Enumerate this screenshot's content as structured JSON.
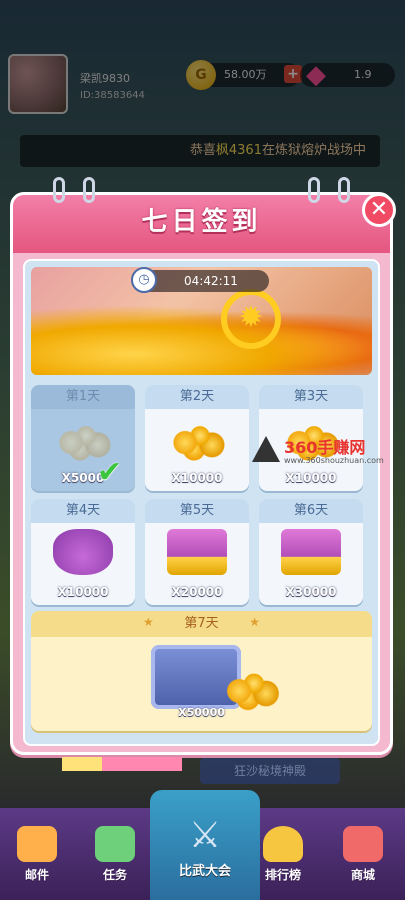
{
  "profile": {
    "name": "梁凯9830",
    "id": "ID:38583644"
  },
  "resources": {
    "coins": "58.00万",
    "coin_symbol": "G",
    "gems": "1.9"
  },
  "ticker": {
    "prefix": "恭喜",
    "name": "枫4361",
    "suffix": "在炼狱熔炉战场中"
  },
  "dialog": {
    "title": "七日签到",
    "timer": "04:42:11",
    "days": [
      {
        "label": "第1天",
        "amount": "X5000",
        "reward": "coins",
        "claimed": true
      },
      {
        "label": "第2天",
        "amount": "X10000",
        "reward": "coins",
        "claimed": false
      },
      {
        "label": "第3天",
        "amount": "X10000",
        "reward": "coins",
        "claimed": false
      },
      {
        "label": "第4天",
        "amount": "X10000",
        "reward": "purse",
        "claimed": false
      },
      {
        "label": "第5天",
        "amount": "X20000",
        "reward": "chest",
        "claimed": false
      },
      {
        "label": "第6天",
        "amount": "X30000",
        "reward": "chest",
        "claimed": false
      }
    ],
    "day7": {
      "label": "第7天",
      "amount": "X50000",
      "reward": "safe"
    }
  },
  "background_button": "狂沙秘境神殿",
  "watermark": {
    "main": "360手赚网",
    "sub": "www.360shouzhuan.com"
  },
  "nav": [
    {
      "label": "邮件",
      "icon": "mail-icon",
      "color": "#ffb04a"
    },
    {
      "label": "任务",
      "icon": "task-icon",
      "color": "#6ed07a"
    },
    {
      "label": "比武大会",
      "icon": "crossed-swords-icon",
      "color": "#3aa0c8"
    },
    {
      "label": "排行榜",
      "icon": "trophy-icon",
      "color": "#f7c640"
    },
    {
      "label": "商城",
      "icon": "shop-icon",
      "color": "#f06a6a"
    }
  ],
  "colors": {
    "accent": "#e4567f",
    "check": "#3cc640"
  }
}
